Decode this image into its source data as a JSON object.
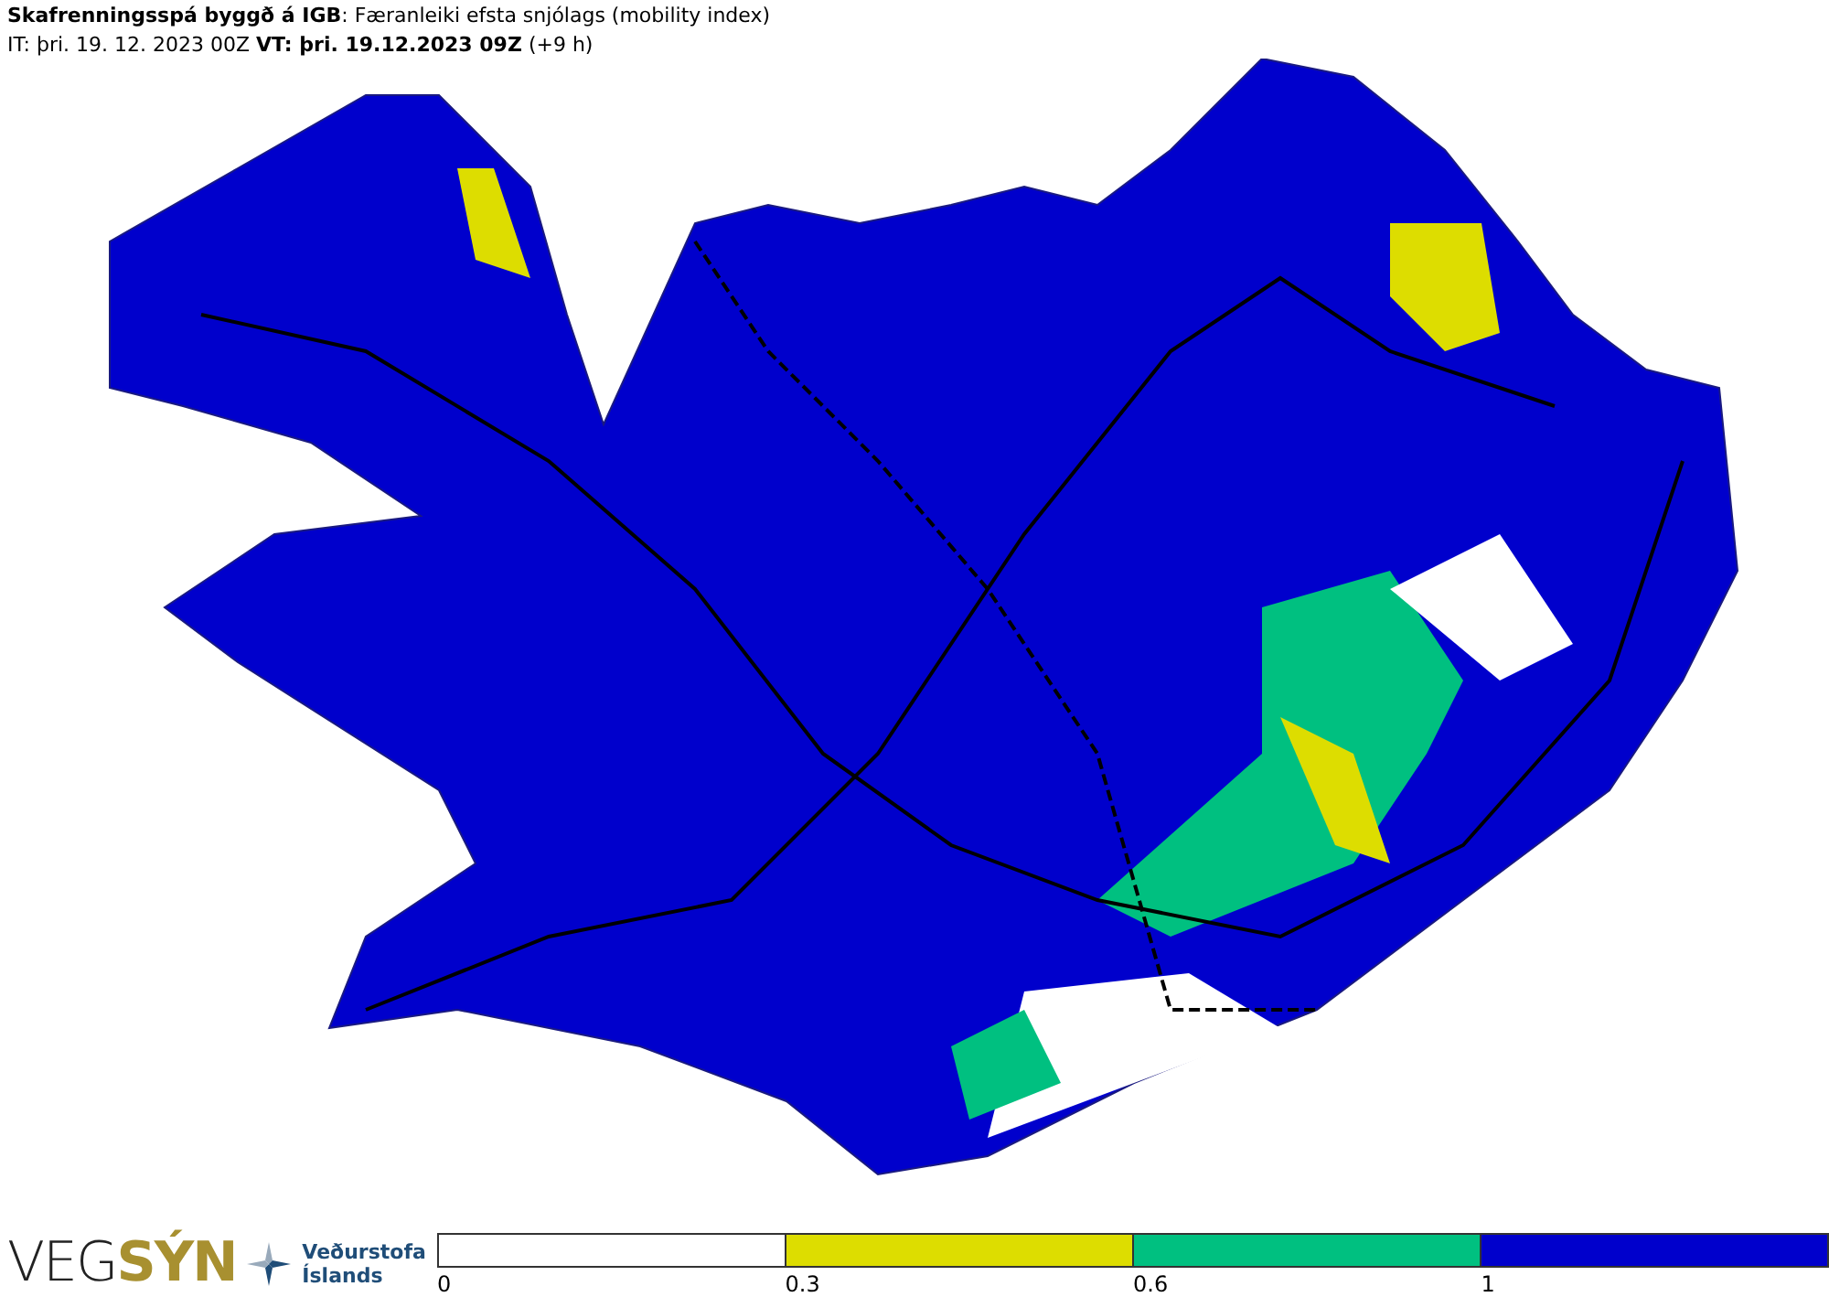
{
  "header": {
    "title": "**Skafrenningsspá byggð á IGB**: Færanleiki efsta snjólags (mobility index)",
    "times": "IT: þri. 19. 12. 2023 00Z **VT: þri. 19.12.2023 09Z** (+9 h)"
  },
  "logos": {
    "vegsyn_part1": "VEG",
    "vegsyn_part2": "SÝN",
    "vedurstofa_line1": "Veðurstofa",
    "vedurstofa_line2": "Íslands"
  },
  "legend": {
    "segments": [
      {
        "color": "#ffffff"
      },
      {
        "color": "#dddd00"
      },
      {
        "color": "#00c080"
      },
      {
        "color": "#0000cc"
      }
    ],
    "ticks": [
      "0",
      "0.3",
      "0.6",
      "1"
    ]
  }
}
